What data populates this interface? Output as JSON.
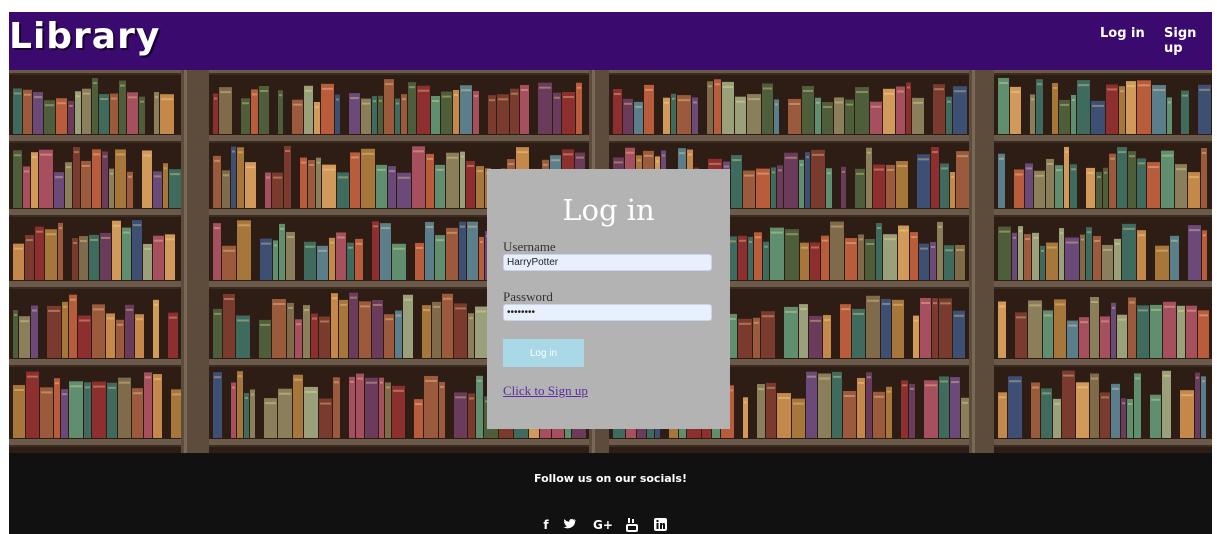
{
  "header": {
    "brand": "Library",
    "nav": {
      "login": "Log in",
      "signup": "Sign up"
    }
  },
  "login_form": {
    "title": "Log in",
    "username_label": "Username",
    "username_value": "HarryPotter",
    "password_label": "Password",
    "password_value": "••••••••",
    "submit_label": "Log in",
    "signup_link": "Click to Sign up"
  },
  "footer": {
    "title": "Follow us on our socials!",
    "socials": [
      "facebook-icon",
      "twitter-icon",
      "google-plus-icon",
      "youtube-icon",
      "linkedin-icon"
    ]
  },
  "colors": {
    "header_bg": "#3b0a6e",
    "panel_bg": "#b3b3b3",
    "button_bg": "#a9d8e6",
    "footer_bg": "#111111",
    "link": "#5a2ca0"
  }
}
